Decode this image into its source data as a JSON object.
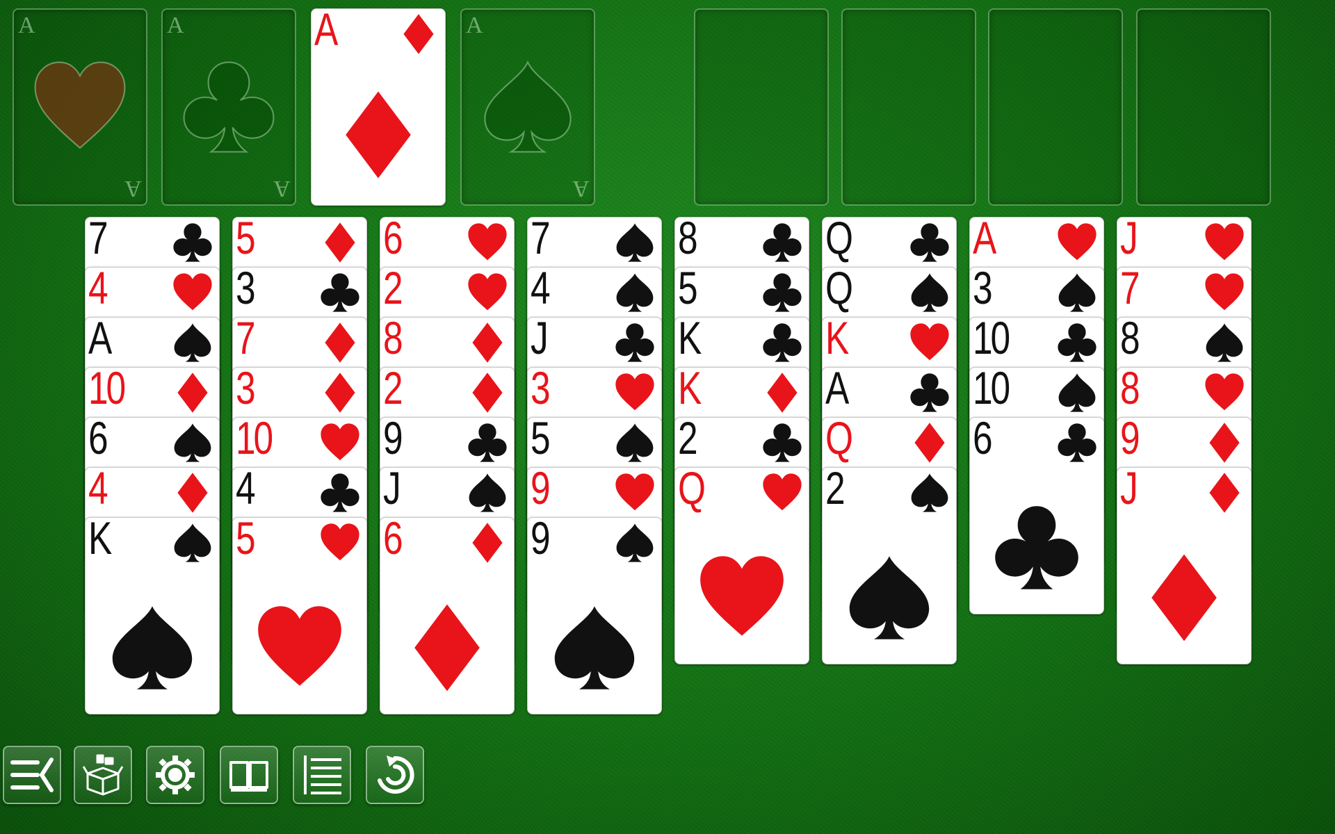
{
  "suit_colors": {
    "hearts": "#e8141a",
    "diamonds": "#e8141a",
    "clubs": "#111111",
    "spades": "#111111"
  },
  "foundations": [
    {
      "suit": "hearts",
      "label": "A",
      "filled": false
    },
    {
      "suit": "clubs",
      "label": "A",
      "filled": false
    },
    {
      "suit": "diamonds",
      "label": "A",
      "filled": true
    },
    {
      "suit": "spades",
      "label": "A",
      "filled": false
    }
  ],
  "freecells": [
    {
      "card": null
    },
    {
      "card": null
    },
    {
      "card": null
    },
    {
      "card": null
    }
  ],
  "columns": [
    [
      {
        "rank": "7",
        "suit": "clubs"
      },
      {
        "rank": "4",
        "suit": "hearts"
      },
      {
        "rank": "A",
        "suit": "spades"
      },
      {
        "rank": "10",
        "suit": "diamonds"
      },
      {
        "rank": "6",
        "suit": "spades"
      },
      {
        "rank": "4",
        "suit": "diamonds"
      },
      {
        "rank": "K",
        "suit": "spades"
      }
    ],
    [
      {
        "rank": "5",
        "suit": "diamonds"
      },
      {
        "rank": "3",
        "suit": "clubs"
      },
      {
        "rank": "7",
        "suit": "diamonds"
      },
      {
        "rank": "3",
        "suit": "diamonds"
      },
      {
        "rank": "10",
        "suit": "hearts"
      },
      {
        "rank": "4",
        "suit": "clubs"
      },
      {
        "rank": "5",
        "suit": "hearts"
      }
    ],
    [
      {
        "rank": "6",
        "suit": "hearts"
      },
      {
        "rank": "2",
        "suit": "hearts"
      },
      {
        "rank": "8",
        "suit": "diamonds"
      },
      {
        "rank": "2",
        "suit": "diamonds"
      },
      {
        "rank": "9",
        "suit": "clubs"
      },
      {
        "rank": "J",
        "suit": "spades"
      },
      {
        "rank": "6",
        "suit": "diamonds"
      }
    ],
    [
      {
        "rank": "7",
        "suit": "spades"
      },
      {
        "rank": "4",
        "suit": "spades"
      },
      {
        "rank": "J",
        "suit": "clubs"
      },
      {
        "rank": "3",
        "suit": "hearts"
      },
      {
        "rank": "5",
        "suit": "spades"
      },
      {
        "rank": "9",
        "suit": "hearts"
      },
      {
        "rank": "9",
        "suit": "spades"
      }
    ],
    [
      {
        "rank": "8",
        "suit": "clubs"
      },
      {
        "rank": "5",
        "suit": "clubs"
      },
      {
        "rank": "K",
        "suit": "clubs"
      },
      {
        "rank": "K",
        "suit": "diamonds"
      },
      {
        "rank": "2",
        "suit": "clubs"
      },
      {
        "rank": "Q",
        "suit": "hearts"
      }
    ],
    [
      {
        "rank": "Q",
        "suit": "clubs"
      },
      {
        "rank": "Q",
        "suit": "spades"
      },
      {
        "rank": "K",
        "suit": "hearts"
      },
      {
        "rank": "A",
        "suit": "clubs"
      },
      {
        "rank": "Q",
        "suit": "diamonds"
      },
      {
        "rank": "2",
        "suit": "spades"
      }
    ],
    [
      {
        "rank": "A",
        "suit": "hearts"
      },
      {
        "rank": "3",
        "suit": "spades"
      },
      {
        "rank": "10",
        "suit": "clubs"
      },
      {
        "rank": "10",
        "suit": "spades"
      },
      {
        "rank": "6",
        "suit": "clubs"
      }
    ],
    [
      {
        "rank": "J",
        "suit": "hearts"
      },
      {
        "rank": "7",
        "suit": "hearts"
      },
      {
        "rank": "8",
        "suit": "spades"
      },
      {
        "rank": "8",
        "suit": "hearts"
      },
      {
        "rank": "9",
        "suit": "diamonds"
      },
      {
        "rank": "J",
        "suit": "diamonds"
      }
    ]
  ],
  "toolbar": [
    {
      "name": "menu-button",
      "icon": "menu-icon"
    },
    {
      "name": "new-game-button",
      "icon": "box-icon"
    },
    {
      "name": "settings-button",
      "icon": "gear-icon"
    },
    {
      "name": "rules-button",
      "icon": "book-icon"
    },
    {
      "name": "statistics-button",
      "icon": "list-icon"
    },
    {
      "name": "undo-button",
      "icon": "undo-icon"
    }
  ]
}
